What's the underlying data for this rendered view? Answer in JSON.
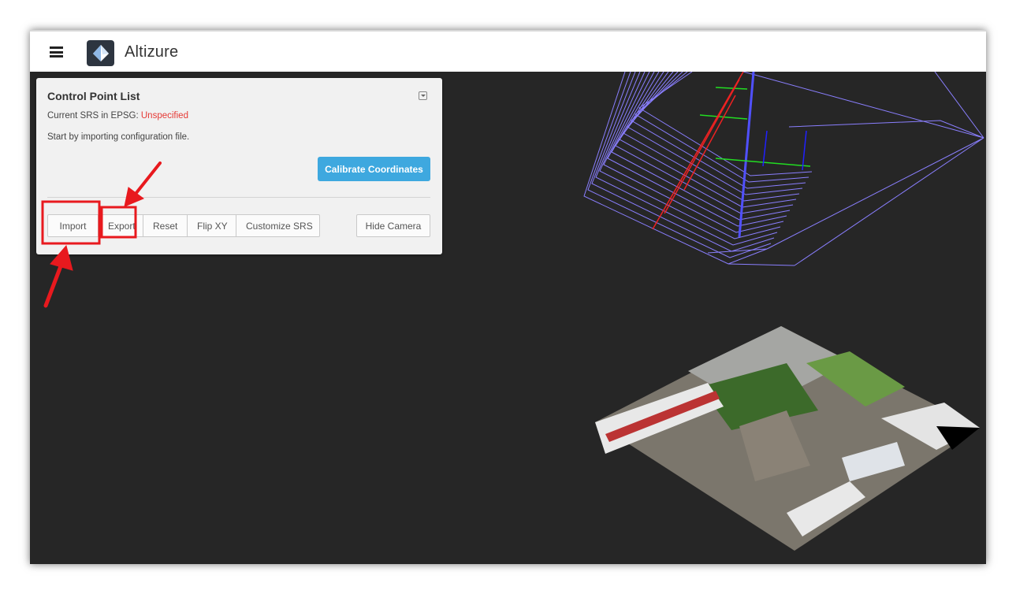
{
  "app": {
    "title": "Altizure"
  },
  "panel": {
    "title": "Control Point List",
    "srs_label": "Current SRS in EPSG: ",
    "srs_value": "Unspecified",
    "hint": "Start by importing configuration file.",
    "calibrate_label": "Calibrate Coordinates",
    "buttons": [
      "Import",
      "Export",
      "Reset",
      "Flip XY",
      "Customize SRS"
    ],
    "hide_camera_label": "Hide Camera"
  },
  "icons": [
    "menu-icon",
    "altizure-logo-icon",
    "collapse-icon"
  ],
  "colors": {
    "accent": "#3ea8df",
    "warning": "#e53935",
    "annotation": "#e8191e",
    "camera_frustum": "#8a7fff"
  }
}
